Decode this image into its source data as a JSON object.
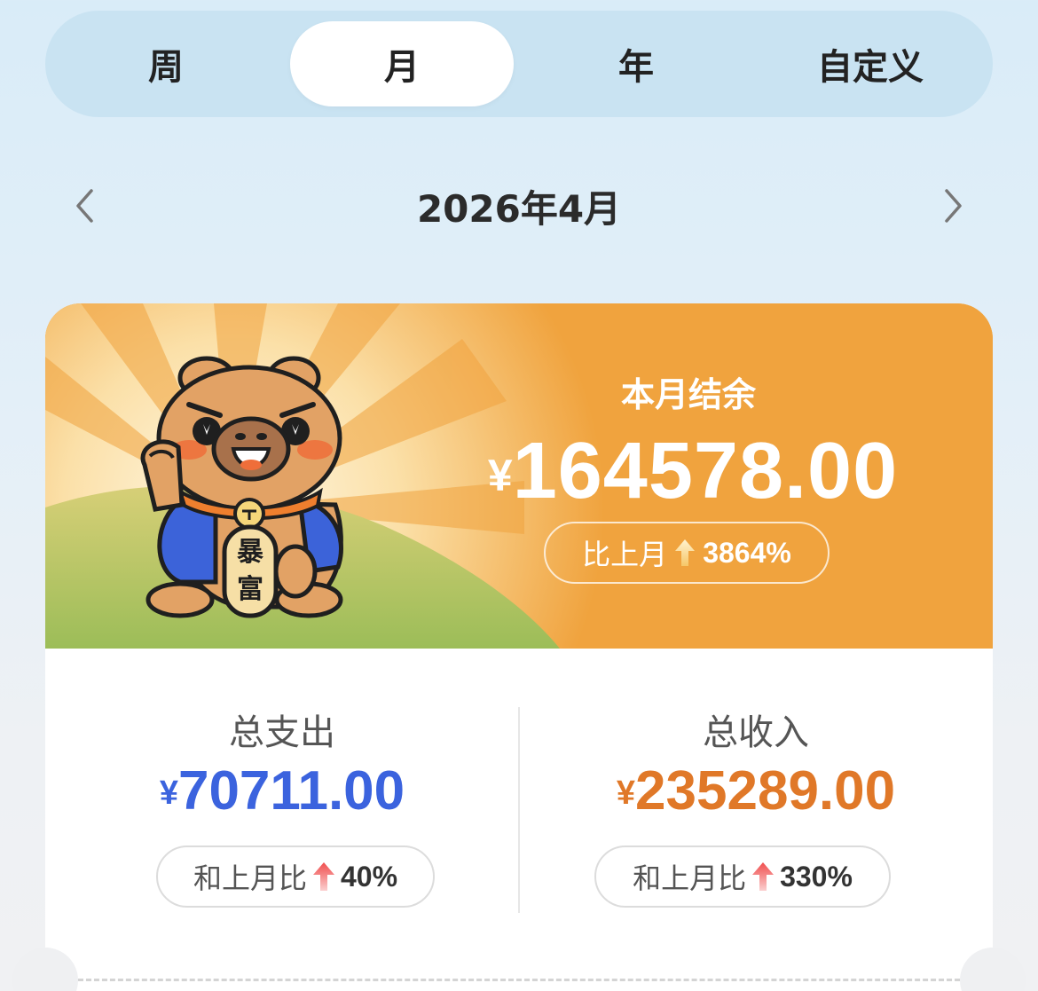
{
  "tabs": [
    {
      "label": "周",
      "active": false
    },
    {
      "label": "月",
      "active": true
    },
    {
      "label": "年",
      "active": false
    },
    {
      "label": "自定义",
      "active": false
    }
  ],
  "period": {
    "label": "2026年4月",
    "prev_icon": "chevron-left-icon",
    "next_icon": "chevron-right-icon"
  },
  "balance": {
    "title": "本月结余",
    "currency": "¥",
    "amount": "164578.00",
    "compare_label": "比上月",
    "compare_icon": "arrow-up-icon",
    "compare_value": "3864%"
  },
  "mascot": {
    "icon": "capybara-mascot-icon",
    "charm_text_1": "暴",
    "charm_text_2": "富"
  },
  "expense": {
    "label": "总支出",
    "currency": "¥",
    "amount": "70711.00",
    "compare_label": "和上月比",
    "compare_icon": "arrow-up-icon",
    "compare_value": "40%"
  },
  "income": {
    "label": "总收入",
    "currency": "¥",
    "amount": "235289.00",
    "compare_label": "和上月比",
    "compare_icon": "arrow-up-icon",
    "compare_value": "330%"
  },
  "colors": {
    "banner": "#f0a33e",
    "expense": "#3b63de",
    "income": "#e07828",
    "tab_bg": "#c9e3f2"
  }
}
